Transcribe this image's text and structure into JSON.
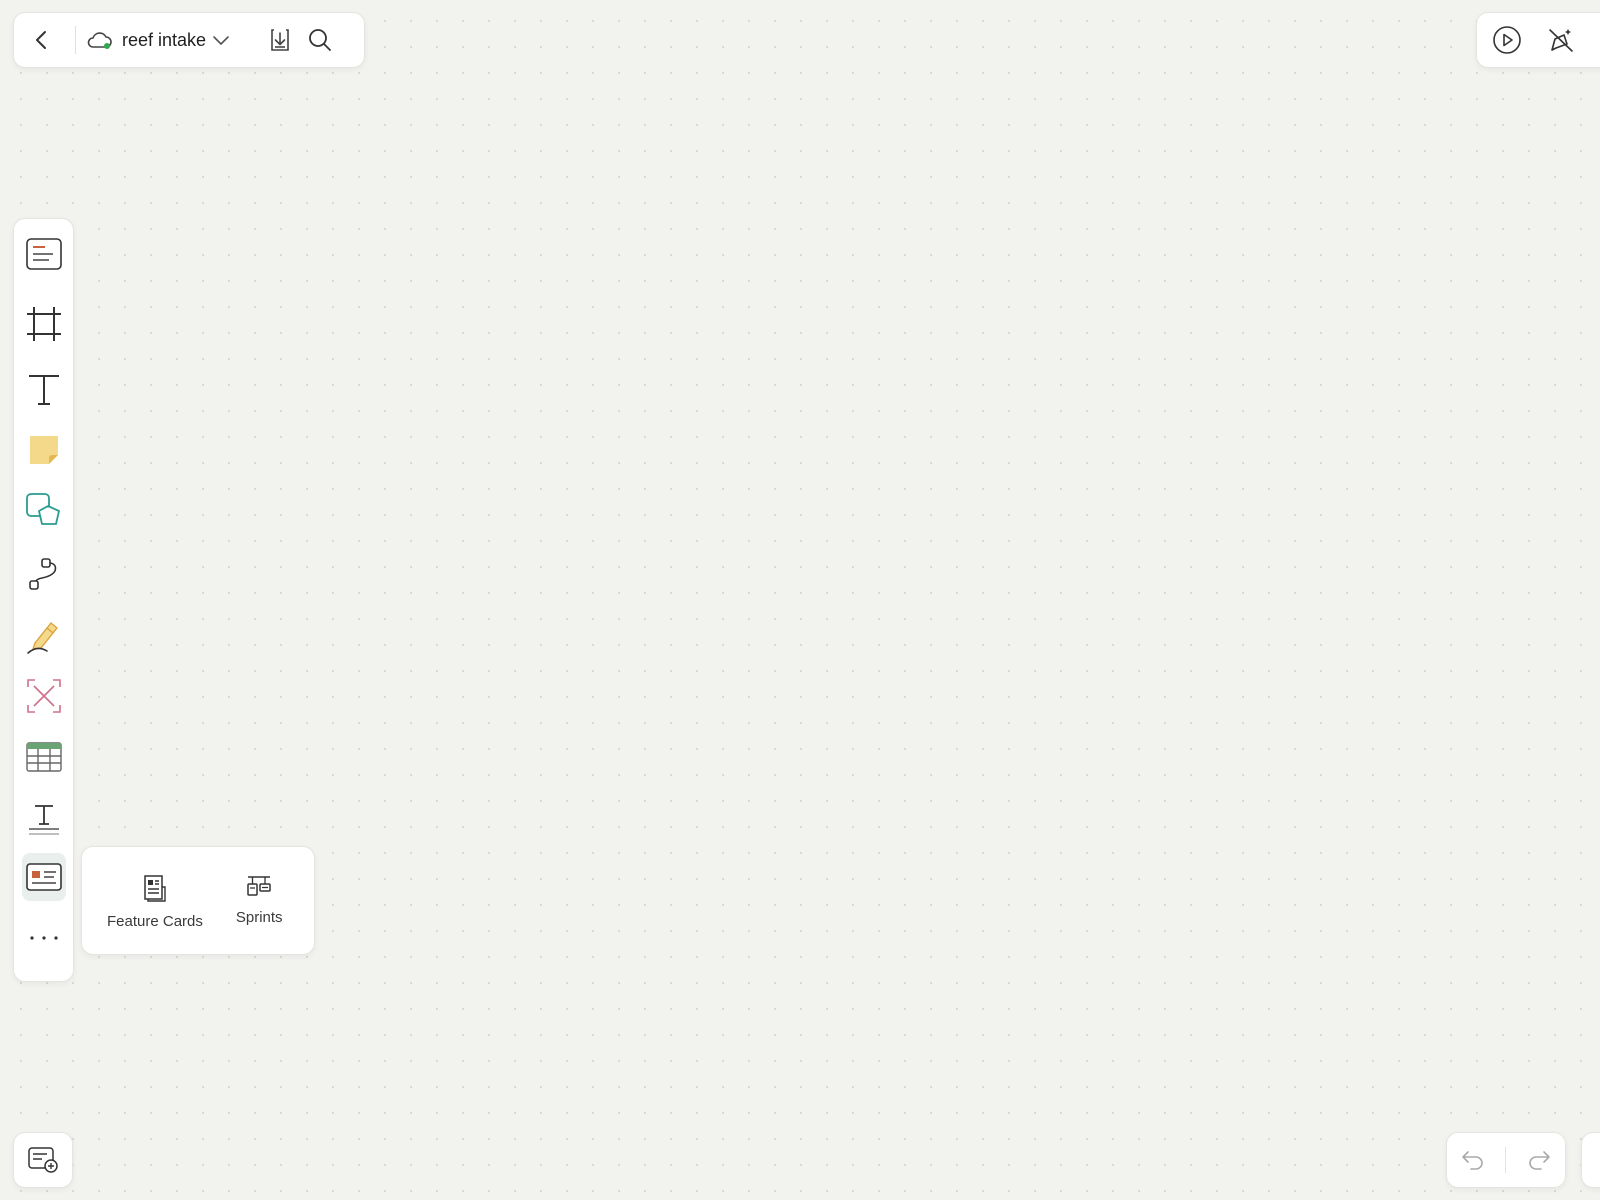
{
  "topbar": {
    "doc_title": "reef intake"
  },
  "popup": {
    "items": [
      {
        "label": "Feature Cards",
        "icon": "feature-cards-icon"
      },
      {
        "label": "Sprints",
        "icon": "sprints-icon"
      }
    ]
  },
  "leftbar": {
    "tools": [
      "note-icon",
      "frame-icon",
      "text-icon",
      "sticky-note-icon",
      "shapes-icon",
      "connector-icon",
      "pen-icon",
      "eraser-icon",
      "table-icon",
      "text-style-icon",
      "card-template-icon",
      "more-icon"
    ],
    "active_tool": "card-template-icon"
  },
  "colors": {
    "background": "#f2f2ef",
    "accent_orange": "#c8623b",
    "sticky_yellow": "#f5d98a",
    "shape_teal": "#2a9d8f",
    "eraser_pink": "#d0708a",
    "table_green": "#6aa374",
    "sync_green": "#2fa84f"
  }
}
